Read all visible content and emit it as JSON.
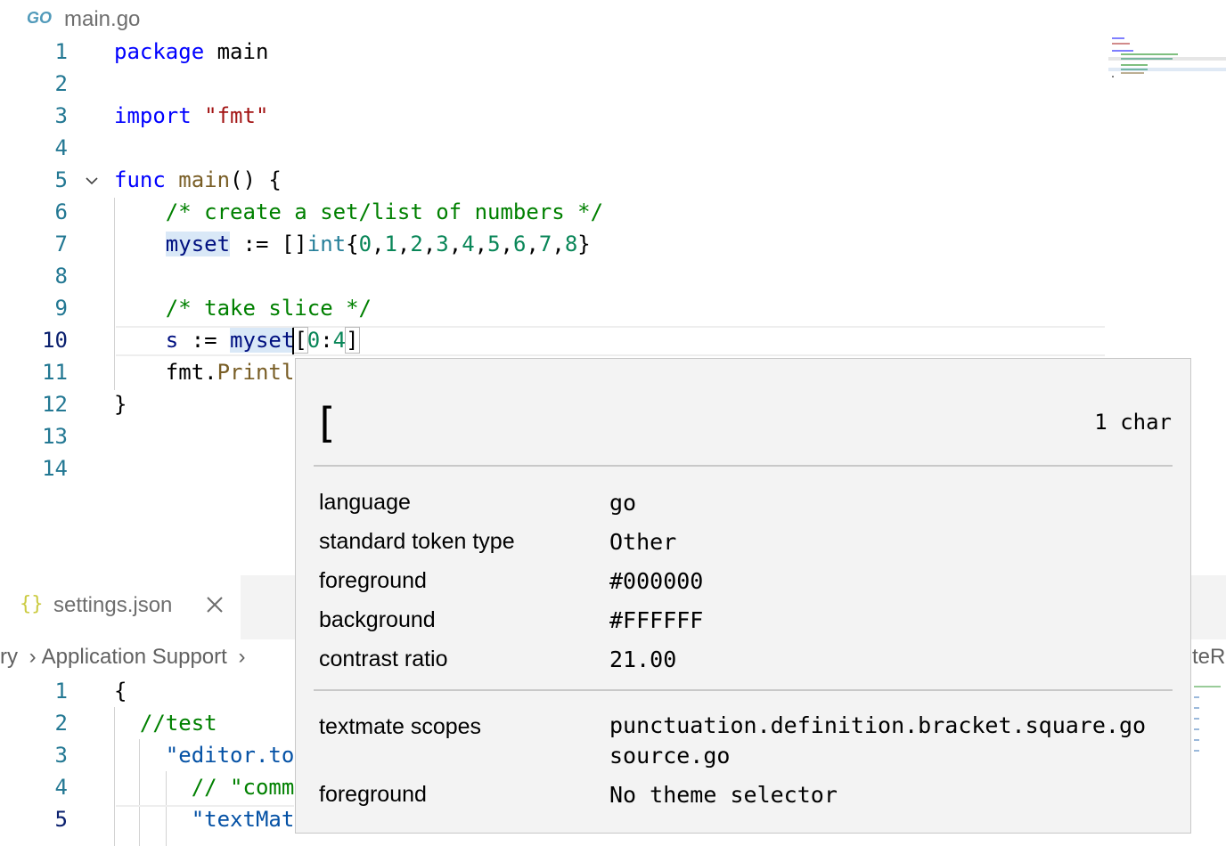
{
  "editor1": {
    "tab_label": "main.go",
    "file_icon": "GO",
    "line_numbers": [
      "1",
      "2",
      "3",
      "4",
      "5",
      "6",
      "7",
      "8",
      "9",
      "10",
      "11",
      "12",
      "13",
      "14"
    ],
    "code": {
      "l1_kw": "package",
      "l1_rest": " main",
      "l3_kw": "import",
      "l3_str": "\"fmt\"",
      "l5_kw": "func",
      "l5_fn": "main",
      "l5_rest": "() {",
      "l6_comment": "/* create a set/list of numbers */",
      "l7_var": "myset",
      "l7_op": " := []",
      "l7_type": "int",
      "l7_open": "{",
      "l7_nums": [
        "0",
        "1",
        "2",
        "3",
        "4",
        "5",
        "6",
        "7",
        "8"
      ],
      "l7_close": "}",
      "l9_comment": "/* take slice */",
      "l10_s": "s",
      "l10_op": " := ",
      "l10_var": "myset",
      "l10_lb": "[",
      "l10_a": "0",
      "l10_colon": ":",
      "l10_b": "4",
      "l10_rb": "]",
      "l11_pkg": "fmt.",
      "l11_fn": "Printl",
      "l12": "}"
    }
  },
  "editor2": {
    "tab_label": "settings.json",
    "breadcrumb_prefix": "ry",
    "breadcrumb_item": "Application Support",
    "right_partial": "teRu",
    "line_numbers": [
      "1",
      "2",
      "3",
      "4",
      "5"
    ],
    "code": {
      "l1": "{",
      "l2": "//test",
      "l3": "\"editor.to",
      "l4": "// \"comm",
      "l5": "\"textMat"
    }
  },
  "hover": {
    "char": "[",
    "count": "1 char",
    "rows": [
      {
        "key": "language",
        "value": "go"
      },
      {
        "key": "standard token type",
        "value": "Other"
      },
      {
        "key": "foreground",
        "value": "#000000"
      },
      {
        "key": "background",
        "value": "#FFFFFF"
      },
      {
        "key": "contrast ratio",
        "value": "21.00"
      }
    ],
    "scopes_key": "textmate scopes",
    "scopes": [
      "punctuation.definition.bracket.square.go",
      "source.go"
    ],
    "fg_key": "foreground",
    "fg_value": "No theme selector"
  },
  "colors": {
    "keyword": "#0000ff",
    "string": "#a31515",
    "function": "#795e26",
    "comment": "#008000",
    "number": "#098658",
    "type": "#267f99",
    "variable": "#001080",
    "line_number": "#237893"
  }
}
